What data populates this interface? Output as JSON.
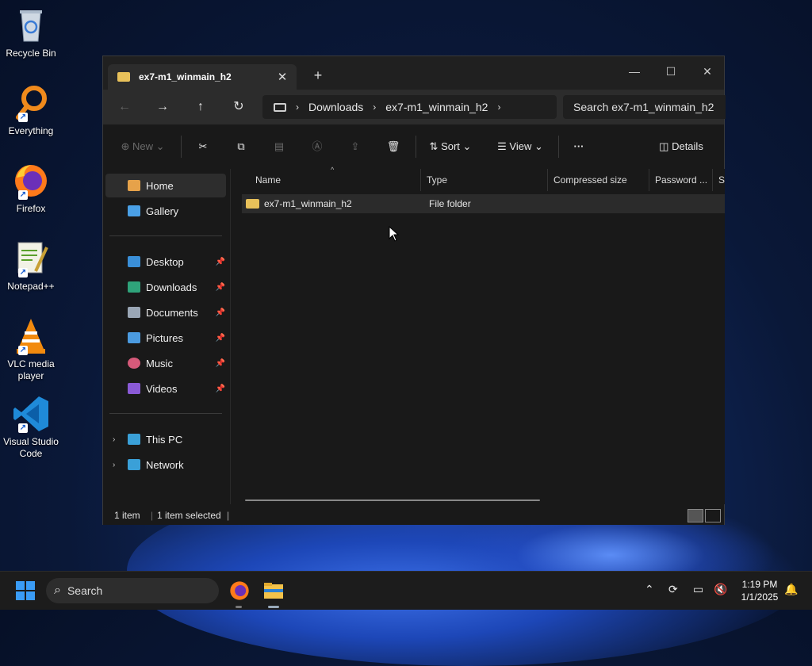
{
  "desktop": {
    "icons": [
      {
        "label": "Recycle Bin"
      },
      {
        "label": "Everything"
      },
      {
        "label": "Firefox"
      },
      {
        "label": "Notepad++"
      },
      {
        "label": "VLC media player"
      },
      {
        "label": "Visual Studio Code"
      }
    ]
  },
  "window": {
    "tab_title": "ex7-m1_winmain_h2",
    "new_tab": "+",
    "controls": {
      "minimize": "—",
      "maximize": "☐",
      "close": "✕"
    },
    "nav": {
      "back": "←",
      "forward": "→",
      "up": "↑",
      "refresh": "↻"
    },
    "breadcrumb": [
      "Downloads",
      "ex7-m1_winmain_h2"
    ],
    "search_placeholder": "Search ex7-m1_winmain_h2",
    "toolbar": {
      "new_label": "New",
      "sort_label": "Sort",
      "view_label": "View",
      "more_label": "···",
      "details_label": "Details"
    },
    "sidebar": {
      "top": [
        {
          "label": "Home"
        },
        {
          "label": "Gallery"
        }
      ],
      "pinned": [
        {
          "label": "Desktop"
        },
        {
          "label": "Downloads"
        },
        {
          "label": "Documents"
        },
        {
          "label": "Pictures"
        },
        {
          "label": "Music"
        },
        {
          "label": "Videos"
        }
      ],
      "bottom": [
        {
          "label": "This PC"
        },
        {
          "label": "Network"
        }
      ]
    },
    "columns": [
      "Name",
      "Type",
      "Compressed size",
      "Password ...",
      "Si"
    ],
    "rows": [
      {
        "name": "ex7-m1_winmain_h2",
        "type": "File folder",
        "compressed_size": "",
        "password": ""
      }
    ],
    "status": {
      "count": "1 item",
      "selected": "1 item selected"
    }
  },
  "taskbar": {
    "search_label": "Search",
    "time": "1:19 PM",
    "date": "1/1/2025"
  },
  "colors": {
    "accent": "#3a9cf5",
    "folder": "#e8c15a",
    "window_bg": "#191919"
  }
}
